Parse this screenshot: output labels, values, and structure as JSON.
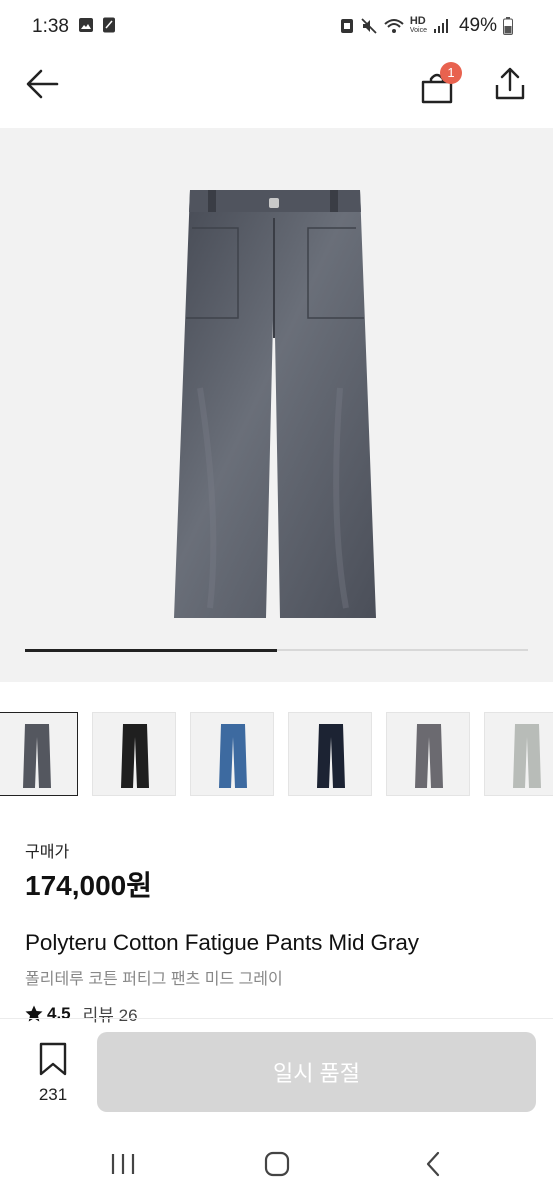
{
  "status_bar": {
    "time": "1:38",
    "battery": "49%",
    "network_label": "HD",
    "network_sublabel": "Voice"
  },
  "header": {
    "cart_count": "1"
  },
  "gallery": {
    "progress_fraction": 0.5,
    "thumbnails": [
      {
        "color": "#54575f",
        "selected": true
      },
      {
        "color": "#1f1f1f",
        "selected": false
      },
      {
        "color": "#3d6aa0",
        "selected": false
      },
      {
        "color": "#1c2333",
        "selected": false
      },
      {
        "color": "#6b6a70",
        "selected": false
      },
      {
        "color": "#b8bcb8",
        "selected": false
      }
    ]
  },
  "product": {
    "price_label": "구매가",
    "price": "174,000원",
    "name_en": "Polyteru Cotton Fatigue Pants Mid Gray",
    "name_ko": "폴리테루 코튼 퍼티그 팬츠 미드 그레이",
    "rating": "4.5",
    "review_label": "리뷰 26"
  },
  "bottom_bar": {
    "bookmark_count": "231",
    "soldout_label": "일시 품절"
  },
  "colors": {
    "badge": "#e8624f",
    "button_disabled": "#d6d6d6"
  }
}
